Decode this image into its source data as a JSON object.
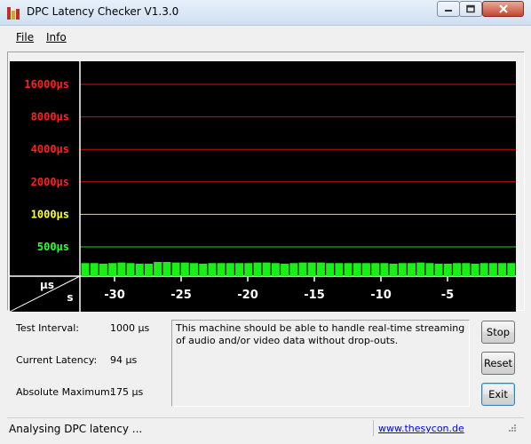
{
  "window": {
    "title": "DPC Latency Checker V1.3.0",
    "minimize_icon": "minimize-icon",
    "maximize_icon": "maximize-icon",
    "close_icon": "close-icon"
  },
  "menu": {
    "items": [
      "File",
      "Info"
    ]
  },
  "graph": {
    "y_labels": [
      {
        "text": "16000µs",
        "color": "#ff2020"
      },
      {
        "text": "8000µs",
        "color": "#ff2020"
      },
      {
        "text": "4000µs",
        "color": "#ff2020"
      },
      {
        "text": "2000µs",
        "color": "#ff2020"
      },
      {
        "text": "1000µs",
        "color": "#ffff40"
      },
      {
        "text": "500µs",
        "color": "#30ff30"
      }
    ],
    "unit_top": "µs",
    "unit_bottom": "s",
    "x_ticks": [
      "-30",
      "-25",
      "-20",
      "-15",
      "-10",
      "-5"
    ],
    "bar_color": "#18f018",
    "bars_us": [
      92,
      92,
      88,
      92,
      96,
      92,
      88,
      88,
      100,
      100,
      96,
      96,
      92,
      88,
      92,
      92,
      92,
      92,
      92,
      96,
      96,
      92,
      88,
      92,
      96,
      96,
      96,
      92,
      92,
      92,
      92,
      92,
      92,
      92,
      88,
      92,
      92,
      96,
      92,
      88,
      88,
      92,
      92,
      88,
      92,
      92,
      92,
      92
    ]
  },
  "info": {
    "test_interval_label": "Test Interval:",
    "test_interval_value": "1000 µs",
    "current_latency_label": "Current Latency:",
    "current_latency_value": "94 µs",
    "absolute_max_label": "Absolute Maximum:",
    "absolute_max_value": "175 µs",
    "message": "This machine should be able to handle real-time streaming of audio and/or video data without drop-outs."
  },
  "buttons": {
    "stop": "Stop",
    "reset": "Reset",
    "exit": "Exit"
  },
  "status": {
    "text": "Analysing DPC latency ...",
    "link": "www.thesycon.de"
  }
}
